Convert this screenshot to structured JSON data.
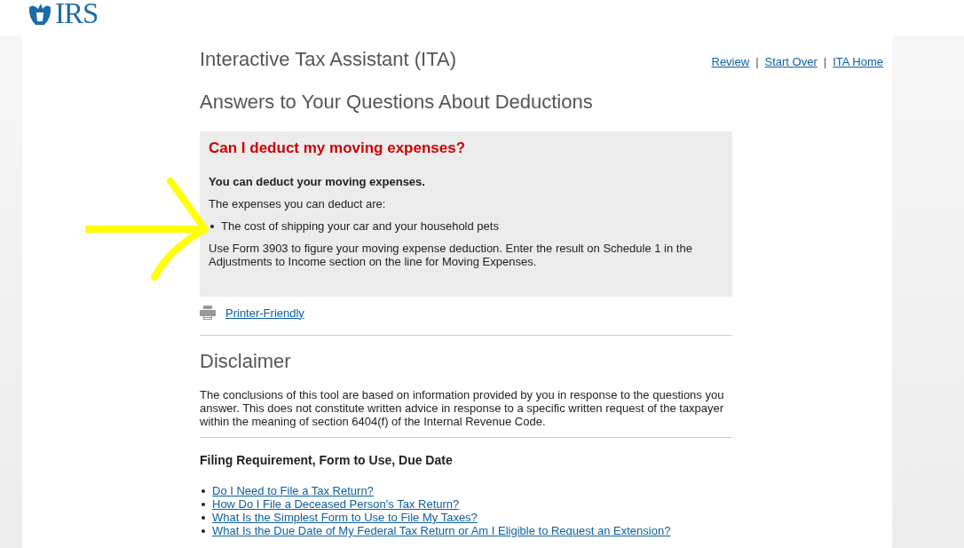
{
  "logo": {
    "text": "IRS"
  },
  "header": {
    "title": "Interactive Tax Assistant (ITA)",
    "links": [
      "Review",
      "Start Over",
      "ITA Home"
    ],
    "separator": "|"
  },
  "page_heading": "Answers to Your Questions About Deductions",
  "answer": {
    "question": "Can I deduct my moving expenses?",
    "verdict": "You can deduct your moving expenses.",
    "intro": "The expenses you can deduct are:",
    "items": [
      "The cost of shipping your car and your household pets"
    ],
    "note": "Use Form 3903 to figure your moving expense deduction. Enter the result on Schedule 1 in the Adjustments to Income section on the line for Moving Expenses."
  },
  "printer_link": "Printer-Friendly",
  "disclaimer": {
    "heading": "Disclaimer",
    "text": "The conclusions of this tool are based on information provided by you in response to the questions you answer. This does not constitute written advice in response to a specific written request of the taxpayer within the meaning of section 6404(f) of the Internal Revenue Code."
  },
  "related": {
    "heading": "Filing Requirement, Form to Use, Due Date",
    "links": [
      "Do I Need to File a Tax Return?",
      "How Do I File a Deceased Person's Tax Return?",
      "What Is the Simplest Form to Use to File My Taxes?",
      "What Is the Due Date of My Federal Tax Return or Am I Eligible to Request an Extension?"
    ]
  }
}
